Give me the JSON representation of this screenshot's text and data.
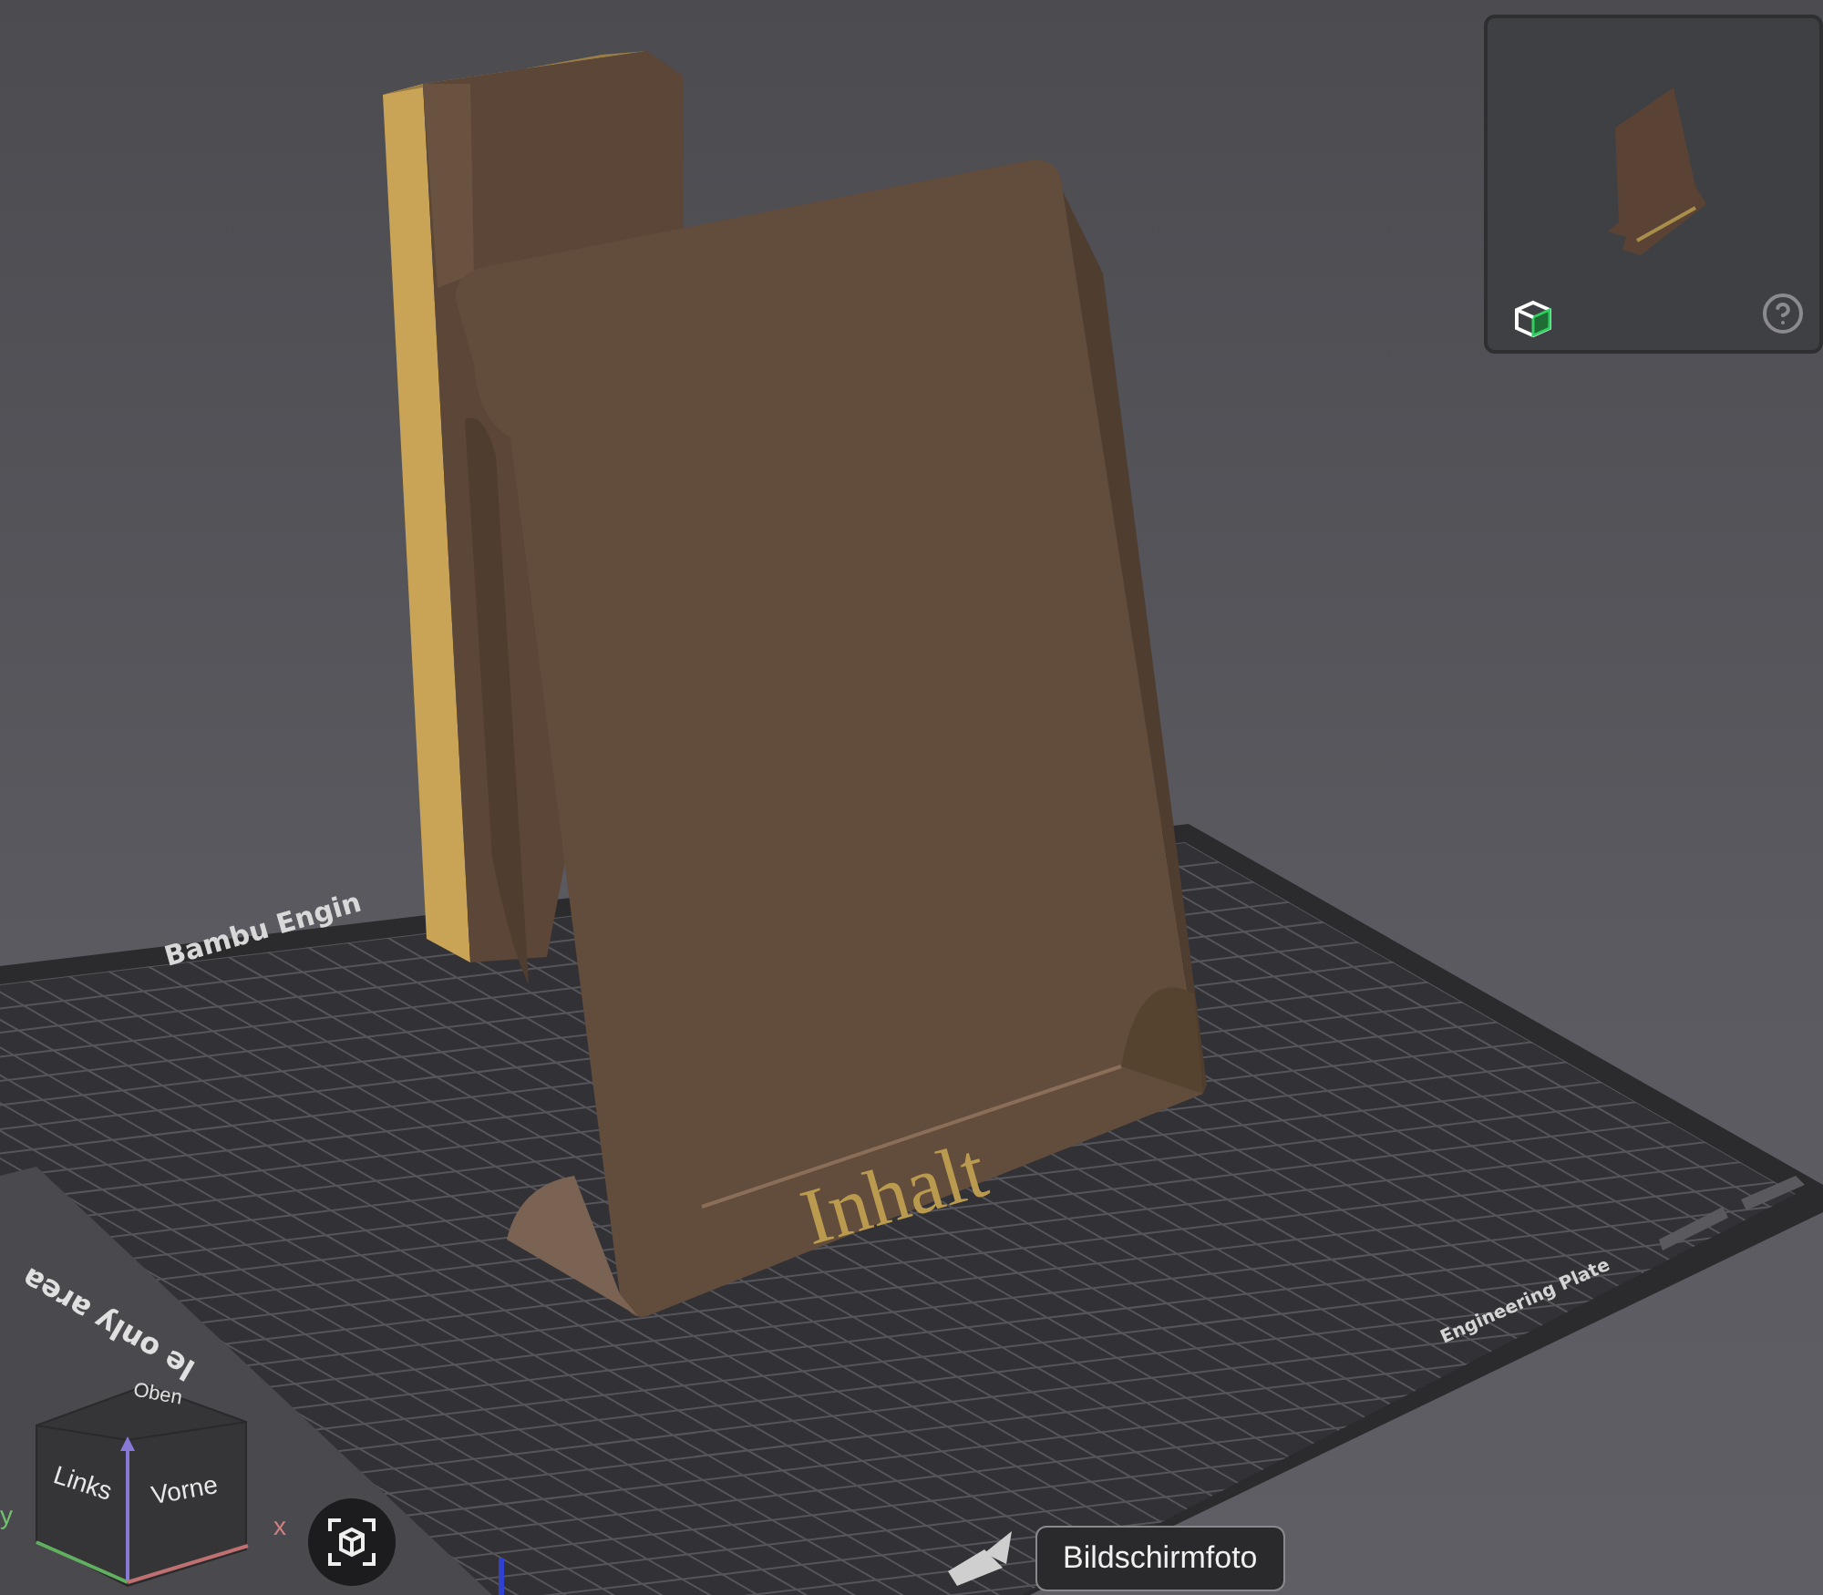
{
  "viewport": {
    "model_label": "Inhalt",
    "bed_labels": [
      {
        "kind": "brand",
        "text": "Bambu Engin"
      },
      {
        "kind": "exclusion",
        "text": "le only area"
      },
      {
        "kind": "plate",
        "text": "Engineering Plate"
      }
    ]
  },
  "nav_cube": {
    "faces": [
      {
        "kind": "top",
        "text": "Oben"
      },
      {
        "kind": "left",
        "text": "Links"
      },
      {
        "kind": "front",
        "text": "Vorne"
      }
    ],
    "axes": [
      {
        "kind": "y",
        "text": "y"
      },
      {
        "kind": "x",
        "text": "x"
      }
    ]
  },
  "tooltip": "Bildschirmfoto"
}
